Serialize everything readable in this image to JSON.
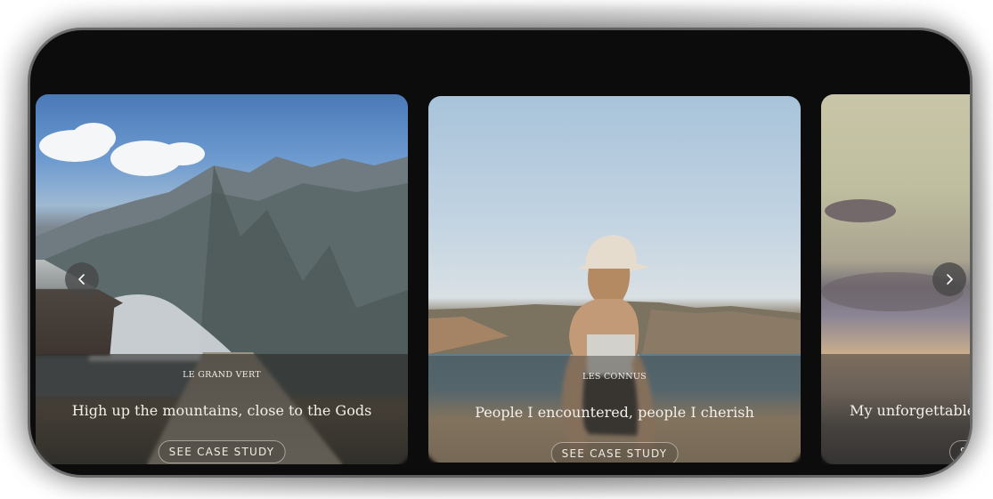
{
  "carousel": {
    "cards": [
      {
        "eyebrow": "LE GRAND VERT",
        "headline": "High up the mountains, close to the Gods",
        "cta": "SEE CASE STUDY"
      },
      {
        "eyebrow": "LES CONNUS",
        "headline": "People I encountered, people I cherish",
        "cta": "SEE CASE STUDY"
      },
      {
        "eyebrow": "",
        "headline": "My unforgettable s",
        "cta": "S"
      }
    ],
    "prev_icon": "chevron-left-icon",
    "next_icon": "chevron-right-icon"
  },
  "colors": {
    "device_bg": "#0c0c0d",
    "overlay": "rgba(40,38,36,0.58)",
    "text": "#f3f0ea"
  }
}
